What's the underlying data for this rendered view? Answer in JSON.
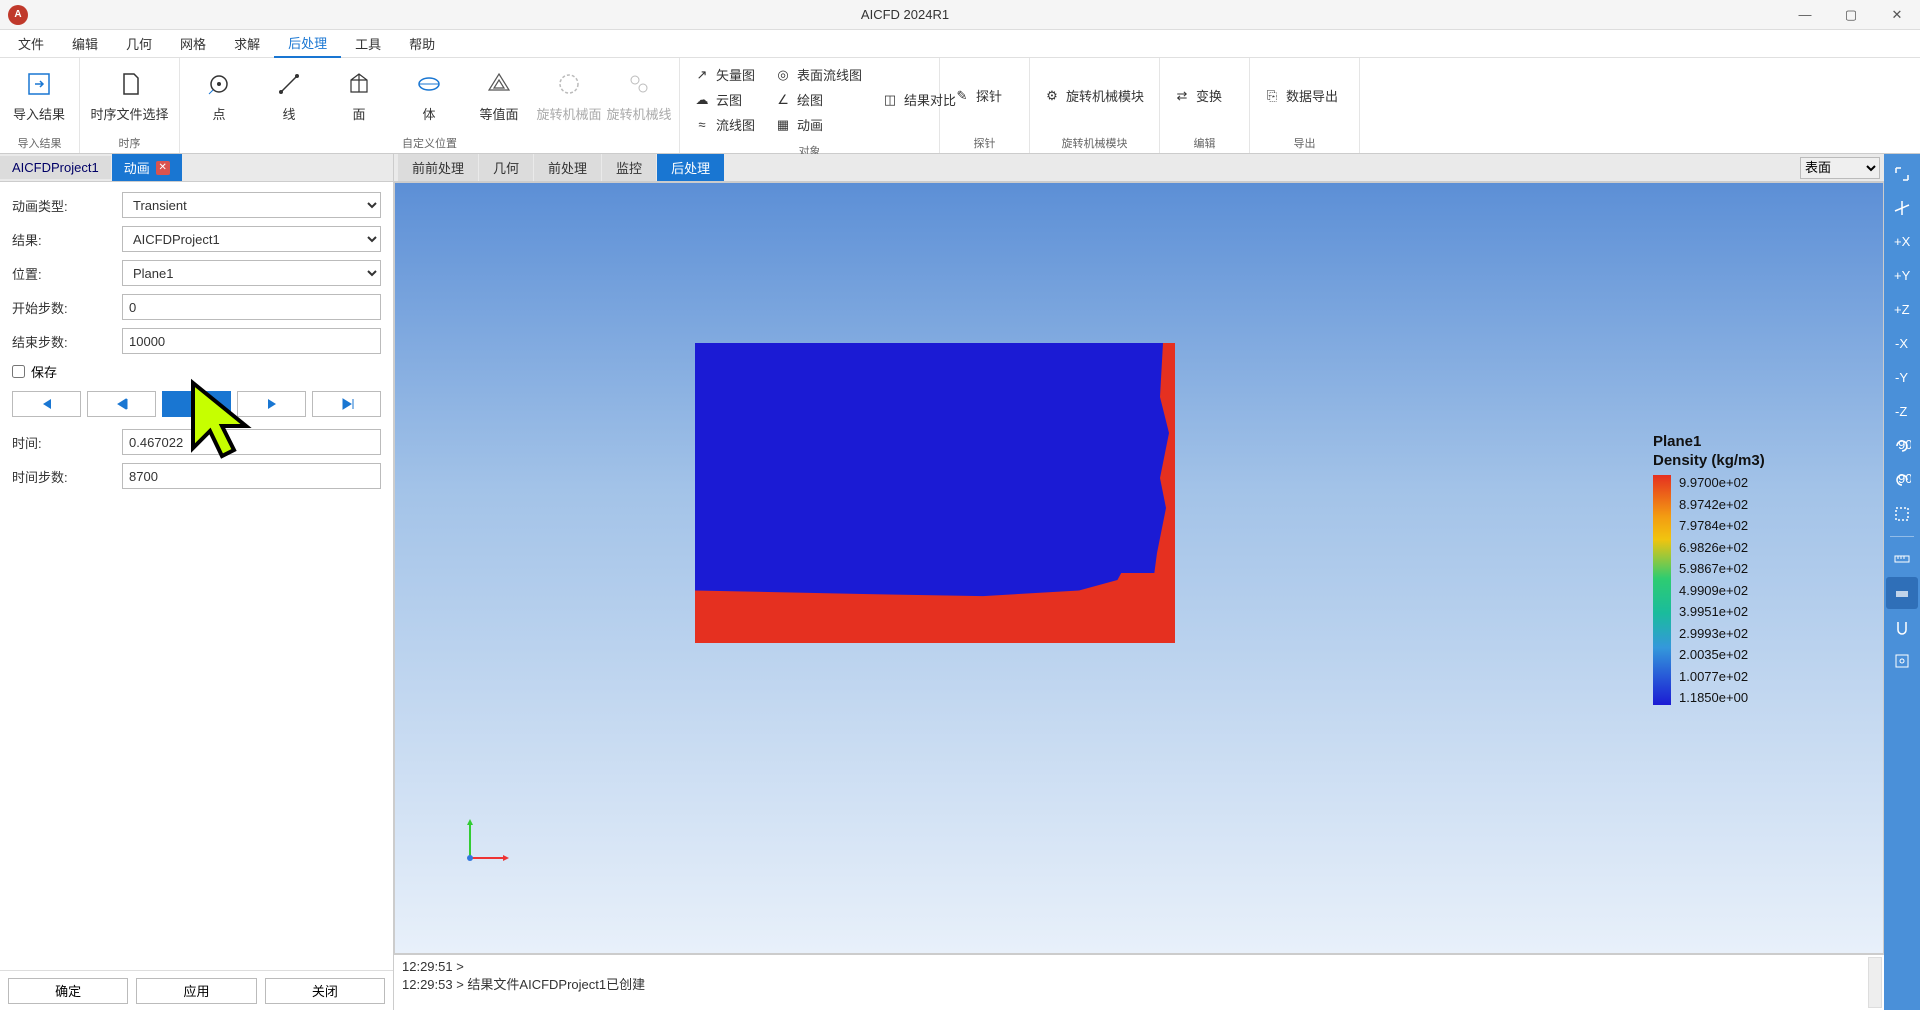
{
  "titlebar": {
    "title": "AICFD 2024R1"
  },
  "menu": {
    "file": "文件",
    "edit": "编辑",
    "geom": "几何",
    "mesh": "网格",
    "solve": "求解",
    "post": "后处理",
    "tools": "工具",
    "help": "帮助"
  },
  "ribbon": {
    "import": "导入结果",
    "timesel": "时序文件选择",
    "point": "点",
    "line": "线",
    "face": "面",
    "body": "体",
    "iso": "等值面",
    "rotm_face": "旋转机械面",
    "rotm_line": "旋转机械线",
    "vec": "矢量图",
    "surfstream": "表面流线图",
    "compare": "结果对比",
    "probe": "探针",
    "rotmod": "旋转机械模块",
    "transform": "变换",
    "export": "数据导出",
    "cloud": "云图",
    "plot": "绘图",
    "stream": "流线图",
    "anim": "动画",
    "g1": "导入结果",
    "g2": "时序",
    "g3": "自定义位置",
    "g4": "对象",
    "g5": "探针",
    "g6": "旋转机械模块",
    "g7": "编辑",
    "g8": "导出"
  },
  "left_tabs": {
    "t0": "AICFDProject1",
    "t1": "动画"
  },
  "view_tabs": {
    "t0": "前前处理",
    "t1": "几何",
    "t2": "前处理",
    "t3": "监控",
    "t4": "后处理",
    "dd": "表面"
  },
  "form": {
    "anim_type_label": "动画类型:",
    "anim_type": "Transient",
    "result_label": "结果:",
    "result": "AICFDProject1",
    "pos_label": "位置:",
    "pos": "Plane1",
    "start_label": "开始步数:",
    "start": "0",
    "end_label": "结束步数:",
    "end": "10000",
    "save": "保存",
    "time_label": "时间:",
    "time": "0.467022",
    "step_label": "时间步数:",
    "step": "8700",
    "ok": "确定",
    "apply": "应用",
    "close": "关闭"
  },
  "legend": {
    "t1": "Plane1",
    "t2": "Density (kg/m3)",
    "ticks": [
      "9.9700e+02",
      "8.9742e+02",
      "7.9784e+02",
      "6.9826e+02",
      "5.9867e+02",
      "4.9909e+02",
      "3.9951e+02",
      "2.9993e+02",
      "2.0035e+02",
      "1.0077e+02",
      "1.1850e+00"
    ]
  },
  "console": {
    "l1": "12:29:51 >",
    "l2": "12:29:53 > 结果文件AICFDProject1已创建"
  }
}
